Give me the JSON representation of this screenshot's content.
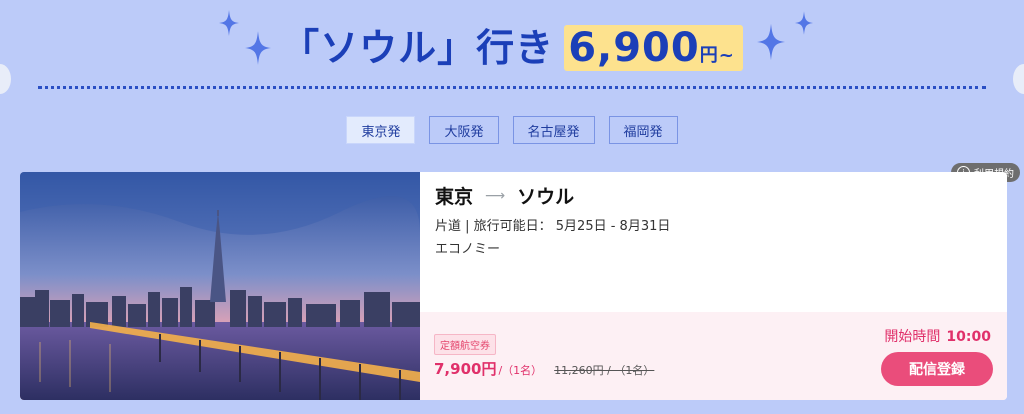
{
  "banner": {
    "title": "「ソウル」行き",
    "price": "6,900",
    "price_suffix": "円~"
  },
  "tabs": [
    {
      "label": "東京発",
      "active": true
    },
    {
      "label": "大阪発",
      "active": false
    },
    {
      "label": "名古屋発",
      "active": false
    },
    {
      "label": "福岡発",
      "active": false
    }
  ],
  "terms_label": "利用規約",
  "card": {
    "origin": "東京",
    "destination": "ソウル",
    "trip_info": "片道 | 旅行可能日： 5月25日 - 8月31日",
    "cabin": "エコノミー",
    "fare_type": "定額航空券",
    "price": "7,900円",
    "price_per": "/（1名）",
    "old_price": "11,260円 / （1名）",
    "start_label": "開始時間",
    "start_time": "10:00",
    "register_button": "配信登録"
  },
  "colors": {
    "background": "#bccbf9",
    "accent_blue": "#1b3fb8",
    "highlight": "#fde28e",
    "pink": "#ea4d7b"
  }
}
